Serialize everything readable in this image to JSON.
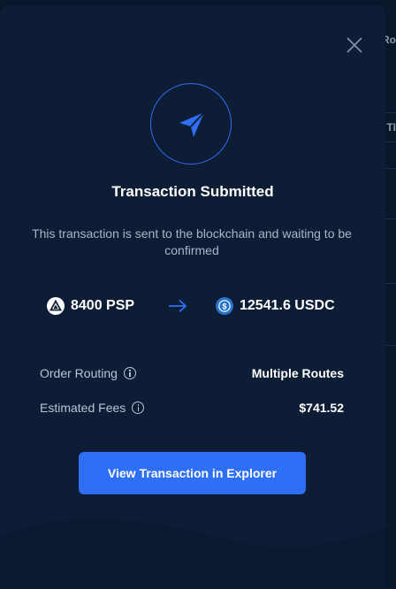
{
  "background": {
    "strip_text_top": "Ro",
    "strip_text_header": "TI"
  },
  "modal": {
    "close_icon": "close-icon",
    "status_icon": "paper-plane-icon",
    "title": "Transaction Submitted",
    "subtitle": "This transaction is sent to the blockchain and waiting to be confirmed",
    "swap": {
      "from_icon": "psp-token-icon",
      "from_text": "8400 PSP",
      "arrow_icon": "arrow-right-icon",
      "to_icon": "usdc-token-icon",
      "to_text": "12541.6 USDC"
    },
    "details": [
      {
        "label": "Order Routing",
        "value": "Multiple Routes",
        "icon": "info-icon"
      },
      {
        "label": "Estimated Fees",
        "value": "$741.52",
        "icon": "info-icon"
      }
    ],
    "cta_label": "View Transaction in Explorer"
  },
  "colors": {
    "accent": "#2f6ff5",
    "modal_bg": "#0d1d35",
    "muted_text": "#a9b6c8"
  }
}
